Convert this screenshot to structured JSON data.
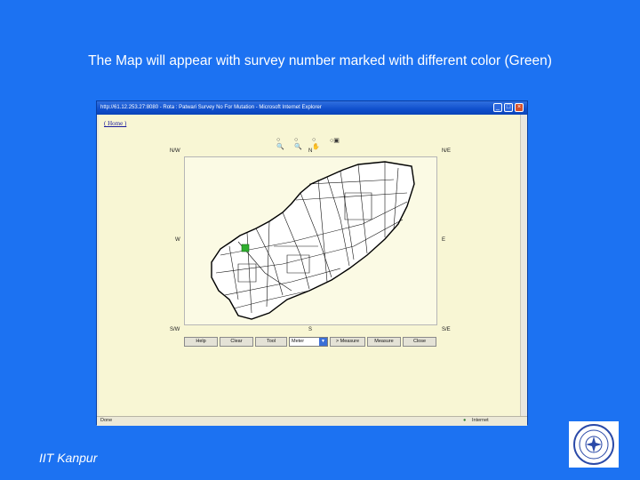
{
  "slide": {
    "caption": "The Map will appear with survey number marked with different color (Green)",
    "footer": "IIT Kanpur",
    "logo_icon": "institute-seal-icon"
  },
  "browser": {
    "title": "http://61.12.253.27:8080 - Rota : Patwari Survey No For Mutation - Microsoft Internet Explorer",
    "home_link": "( Home )",
    "status_left": "Done",
    "status_right": "Internet"
  },
  "map": {
    "directions": {
      "nw": "N/W",
      "n": "N",
      "ne": "N/E",
      "w": "W",
      "e": "E",
      "sw": "S/W",
      "s": "S",
      "se": "S/E"
    },
    "highlight_color": "#2fae2f",
    "tools": [
      "zoom-in-icon",
      "zoom-out-icon",
      "pan-icon",
      "full-extent-icon"
    ]
  },
  "buttons": {
    "help": "Help",
    "clear": "Clear",
    "tool": "Tool",
    "units_selected": "Meter",
    "measure": "> Measure",
    "measure2": "Measure",
    "close": "Close"
  },
  "colors": {
    "slide_background": "#1c72f2",
    "page_background": "#f8f6d4"
  }
}
